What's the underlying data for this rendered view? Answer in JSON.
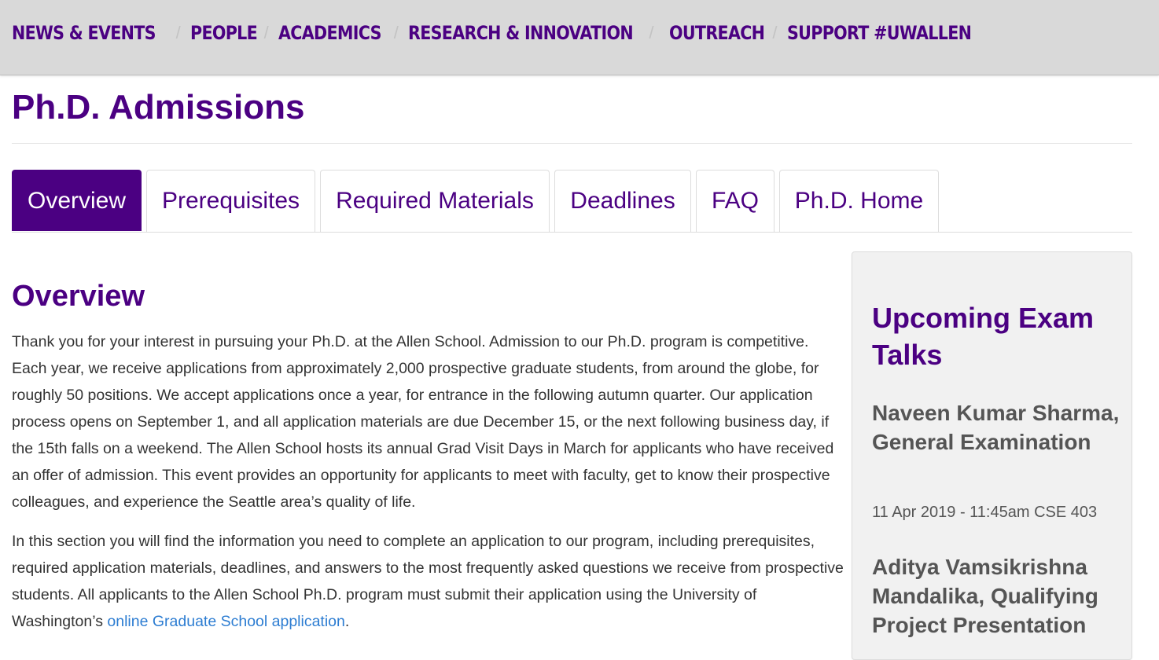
{
  "nav": {
    "items": [
      {
        "label": "NEWS & EVENTS"
      },
      {
        "label": "PEOPLE"
      },
      {
        "label": "ACADEMICS"
      },
      {
        "label": "RESEARCH & INNOVATION"
      },
      {
        "label": "OUTREACH"
      },
      {
        "label": "SUPPORT #UWALLEN"
      }
    ],
    "separator": "/"
  },
  "page": {
    "title": "Ph.D. Admissions"
  },
  "tabs": [
    {
      "label": "Overview",
      "active": true
    },
    {
      "label": "Prerequisites",
      "active": false
    },
    {
      "label": "Required Materials",
      "active": false
    },
    {
      "label": "Deadlines",
      "active": false
    },
    {
      "label": "FAQ",
      "active": false
    },
    {
      "label": "Ph.D. Home",
      "active": false
    }
  ],
  "main": {
    "heading": "Overview",
    "paragraph1": "Thank you for your interest in pursuing your Ph.D. at the Allen School. Admission to our Ph.D. program is competitive. Each year, we receive applications from approximately 2,000 prospective graduate students, from around the globe, for roughly 50 positions. We accept applications once a year, for entrance in the following autumn quarter. Our application process opens on September 1, and all application materials are due December 15, or the next following business day, if the 15th falls on a weekend. The Allen School hosts its annual Grad Visit Days in March for applicants who have received an offer of admission. This event provides an opportunity for applicants to meet with faculty, get to know their prospective colleagues, and experience the Seattle area’s quality of life.",
    "paragraph2_text": "In this section you will find the information you need to complete an application to our program, including prerequisites, required application materials, deadlines, and answers to the most frequently asked questions we receive from prospective students. All applicants to the Allen School Ph.D. program must submit their application using the University of Washington’s ",
    "paragraph2_link": "online Graduate School application",
    "paragraph2_end": "."
  },
  "sidebar": {
    "title": "Upcoming Exam Talks",
    "talks": [
      {
        "title": "Naveen Kumar Sharma, General Examination",
        "meta": "11 Apr 2019 - 11:45am CSE 403"
      },
      {
        "title": "Aditya Vamsikrishna Mandalika, Qualifying Project Presentation"
      }
    ]
  },
  "colors": {
    "brand_purple": "#4b0082",
    "link_blue": "#2d7dd2",
    "nav_bg": "#d9d9d9",
    "sidebar_bg": "#f1f1f1",
    "text": "#333333"
  }
}
